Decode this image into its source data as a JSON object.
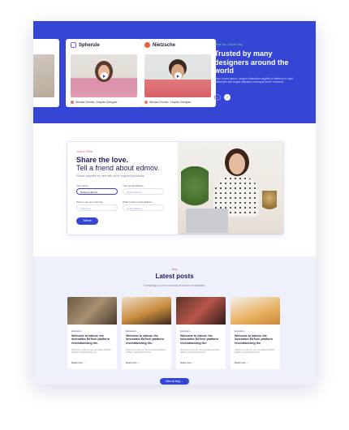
{
  "hero": {
    "cards": [
      {
        "brand": "Spherule",
        "author": "Nikolas Zimmer, Graphic Designer",
        "logo_color": "#7b61ff"
      },
      {
        "brand": "Nietzsche",
        "author": "Nikolas Zimmer, Graphic Designer",
        "logo_color": "#f25c3b"
      }
    ],
    "eyebrow": "What Our Clients Say",
    "title": "Trusted by many designers around the world",
    "text": "Nunc a sem ipsum, congue bibendum sagittis in eleifend et, eget sollicitudin sed augue aliquam consequat lorem euismod.",
    "prev_icon": "arrow-left-icon",
    "next_icon": "arrow-right-icon",
    "accent": "#3545d4"
  },
  "share": {
    "eyebrow": "Invite a Friend",
    "title": "Share the love.",
    "title2": "Tell a friend about edmov.",
    "desc": "Please complete the form with all the required information.",
    "fields": [
      {
        "label": "Your name",
        "value": "Rebecca Brown",
        "placeholder": ""
      },
      {
        "label": "Your email address",
        "value": "",
        "placeholder": "Email address"
      },
      {
        "label": "Person you are referring",
        "value": "",
        "placeholder": "Full name"
      },
      {
        "label": "What is their email address",
        "value": "",
        "placeholder": "Email address"
      }
    ],
    "submit": "Submit"
  },
  "blog": {
    "eyebrow": "Blog",
    "title": "Latest posts",
    "subtitle": "Everything you need to study and learn the platform.",
    "posts": [
      {
        "category": "Education",
        "title": "Welcome to edmov, the innovative EdTech platform revolutionizing the.",
        "desc": "Welcome to edmov, the innovative EdTech platform revolutionizing the.",
        "read_more": "Read more →"
      },
      {
        "category": "Education",
        "title": "Welcome to edmov, the innovative EdTech platform revolutionizing the.",
        "desc": "Welcome to edmov, the innovative EdTech platform revolutionizing the.",
        "read_more": "Read more →"
      },
      {
        "category": "Education",
        "title": "Welcome to edmov, the innovative EdTech platform revolutionizing the.",
        "desc": "Welcome to edmov, the innovative EdTech platform revolutionizing the.",
        "read_more": "Read more →"
      },
      {
        "category": "Education",
        "title": "Welcome to edmov, the innovative EdTech platform revolutionizing the.",
        "desc": "Welcome to edmov, the innovative EdTech platform revolutionizing the.",
        "read_more": "Read more →"
      }
    ],
    "view_all": "View all blog →"
  }
}
